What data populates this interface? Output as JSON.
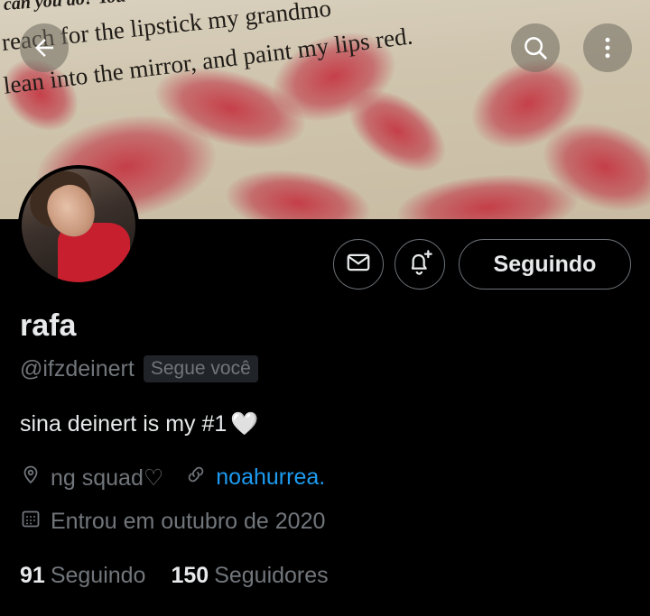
{
  "banner": {
    "line1": "can you do? You",
    "line2": "reach for the lipstick my grandmo",
    "line3": "lean into the mirror, and paint my lips red."
  },
  "profile": {
    "name": "rafa",
    "handle": "@ifzdeinert",
    "follows_you_badge": "Segue você",
    "bio": "sina deinert is my #1",
    "bio_emoji": "🤍",
    "location": "ng squad♡",
    "link": "noahurrea.",
    "joined": "Entrou em outubro de 2020",
    "following_count": "91",
    "following_label": "Seguindo",
    "followers_count": "150",
    "followers_label": "Seguidores"
  },
  "actions": {
    "follow_button_label": "Seguindo"
  },
  "icons": {
    "back": "arrow-left-icon",
    "search": "search-icon",
    "more": "more-vertical-icon",
    "message": "envelope-icon",
    "notify": "bell-plus-icon",
    "location": "location-pin-icon",
    "link": "link-icon",
    "calendar": "calendar-icon"
  },
  "colors": {
    "background": "#000000",
    "text_primary": "#e7e9ea",
    "text_secondary": "#71767b",
    "link": "#1d9bf0",
    "border": "#6e7378"
  }
}
